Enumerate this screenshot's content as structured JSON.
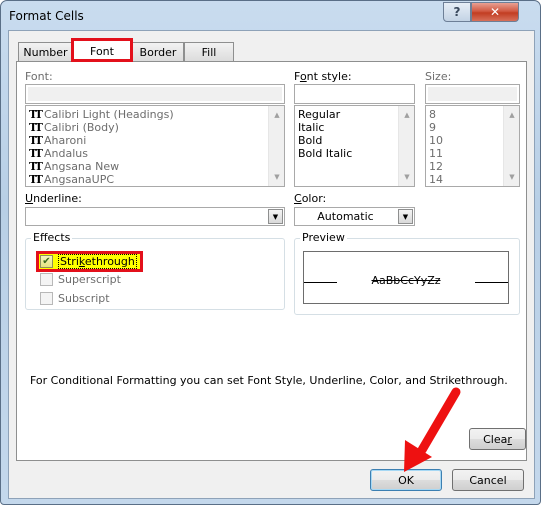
{
  "window": {
    "title": "Format Cells",
    "help_icon": "?",
    "close_icon": "✕"
  },
  "tabs": [
    {
      "label": "Number",
      "active": false
    },
    {
      "label": "Font",
      "active": true
    },
    {
      "label": "Border",
      "active": false
    },
    {
      "label": "Fill",
      "active": false
    }
  ],
  "font": {
    "label": "Font:",
    "value": "",
    "items": [
      "Calibri Light (Headings)",
      "Calibri (Body)",
      "Aharoni",
      "Andalus",
      "Angsana New",
      "AngsanaUPC"
    ],
    "item_icon": "TT"
  },
  "font_style": {
    "label_pre": "F",
    "label_mnemonic": "o",
    "label_post": "nt style:",
    "value": "",
    "items": [
      "Regular",
      "Italic",
      "Bold",
      "Bold Italic"
    ]
  },
  "size": {
    "label": "Size:",
    "value": "",
    "items": [
      "8",
      "9",
      "10",
      "11",
      "12",
      "14"
    ]
  },
  "underline": {
    "label_mnemonic": "U",
    "label_post": "nderline:",
    "value": ""
  },
  "color": {
    "label_mnemonic": "C",
    "label_post": "olor:",
    "value": "Automatic"
  },
  "effects": {
    "title": "Effects",
    "items": [
      {
        "label_pre": "Stri",
        "label_mnemonic": "k",
        "label_post": "ethrough",
        "checked": true,
        "enabled": true
      },
      {
        "label_pre": "Superscript",
        "label_mnemonic": "",
        "label_post": "",
        "checked": false,
        "enabled": false
      },
      {
        "label_pre": "Subscript",
        "label_mnemonic": "",
        "label_post": "",
        "checked": false,
        "enabled": false
      }
    ]
  },
  "preview": {
    "title": "Preview",
    "sample_text": "AaBbCcYyZz"
  },
  "info_text": "For Conditional Formatting you can set Font Style, Underline, Color, and Strikethrough.",
  "buttons": {
    "clear_pre": "Clea",
    "clear_mnemonic": "r",
    "ok": "OK",
    "cancel": "Cancel"
  },
  "annotation_colors": {
    "highlight_red": "#e3101b",
    "highlight_yellow": "#ffff00"
  }
}
